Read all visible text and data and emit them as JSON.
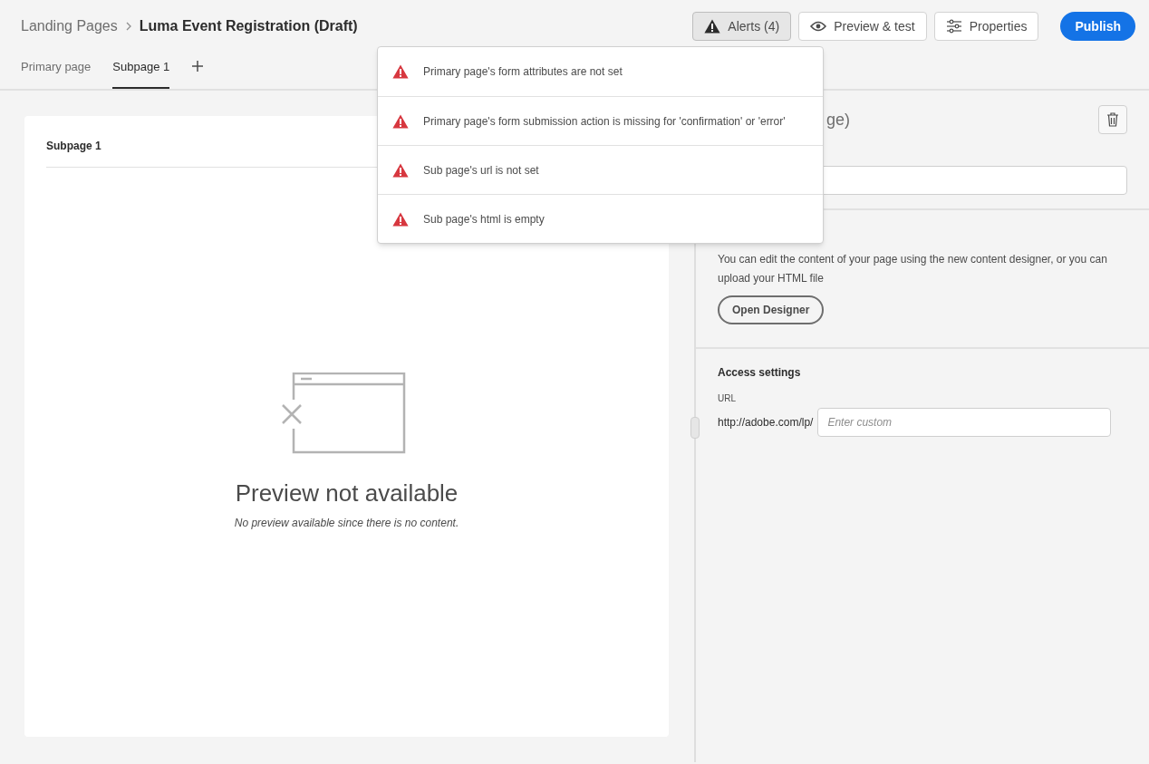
{
  "breadcrumb": {
    "parent": "Landing Pages",
    "current": "Luma Event Registration (Draft)"
  },
  "actions": [
    {
      "kind": "alerts",
      "label": "Alerts (4)"
    },
    {
      "kind": "preview",
      "label": "Preview & test"
    },
    {
      "kind": "properties",
      "label": "Properties"
    },
    {
      "kind": "publish",
      "label": "Publish"
    }
  ],
  "tabs": [
    {
      "label": "Primary page",
      "selected": false
    },
    {
      "label": "Subpage 1",
      "selected": true
    }
  ],
  "alerts": [
    "Primary page's form attributes are not set",
    "Primary page's form submission action is missing for 'confirmation' or 'error'",
    "Sub page's url is not set",
    "Sub page's html is empty"
  ],
  "preview": {
    "title": "Subpage 1",
    "heading": "Preview not available",
    "message": "No preview available since there is no content."
  },
  "panel": {
    "heading": "ge)",
    "content_text": "You can edit the content of your page using the new content designer, or you can upload your HTML file",
    "designer_button": "Open Designer",
    "access": {
      "title": "Access settings",
      "url_label": "URL",
      "url_prefix": "http://adobe.com/lp/",
      "placeholder": "Enter custom"
    }
  }
}
